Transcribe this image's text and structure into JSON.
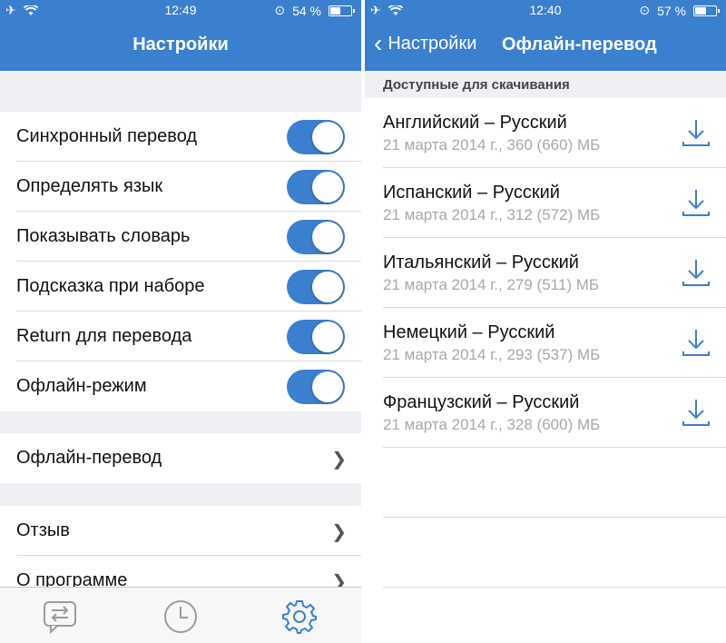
{
  "left": {
    "status": {
      "time": "12:49",
      "battery": "54 %",
      "battery_level": 0.54
    },
    "navbar": {
      "title": "Настройки"
    },
    "toggles": [
      {
        "label": "Синхронный перевод",
        "on": true
      },
      {
        "label": "Определять язык",
        "on": true
      },
      {
        "label": "Показывать словарь",
        "on": true
      },
      {
        "label": "Подсказка при наборе",
        "on": true
      },
      {
        "label": "Return для перевода",
        "on": true
      },
      {
        "label": "Офлайн-режим",
        "on": true
      }
    ],
    "offline_row": {
      "label": "Офлайн-перевод"
    },
    "links": [
      {
        "label": "Отзыв"
      },
      {
        "label": "О программе"
      }
    ],
    "tabs": [
      {
        "icon": "translate-icon"
      },
      {
        "icon": "history-clock-icon"
      },
      {
        "icon": "gear-icon",
        "active": true
      }
    ],
    "accent": "#3b7fcf"
  },
  "right": {
    "status": {
      "time": "12:40",
      "battery": "57 %",
      "battery_level": 0.57
    },
    "navbar": {
      "back_label": "Настройки",
      "title": "Офлайн-перевод"
    },
    "section_header": "Доступные для скачивания",
    "languages": [
      {
        "name": "Английский – Русский",
        "meta": "21 марта 2014 г., 360 (660) МБ"
      },
      {
        "name": "Испанский – Русский",
        "meta": "21 марта 2014 г., 312 (572) МБ"
      },
      {
        "name": "Итальянский – Русский",
        "meta": "21 марта 2014 г., 279 (511) МБ"
      },
      {
        "name": "Немецкий – Русский",
        "meta": "21 марта 2014 г., 293 (537) МБ"
      },
      {
        "name": "Французский – Русский",
        "meta": "21 марта 2014 г., 328 (600) МБ"
      }
    ]
  }
}
